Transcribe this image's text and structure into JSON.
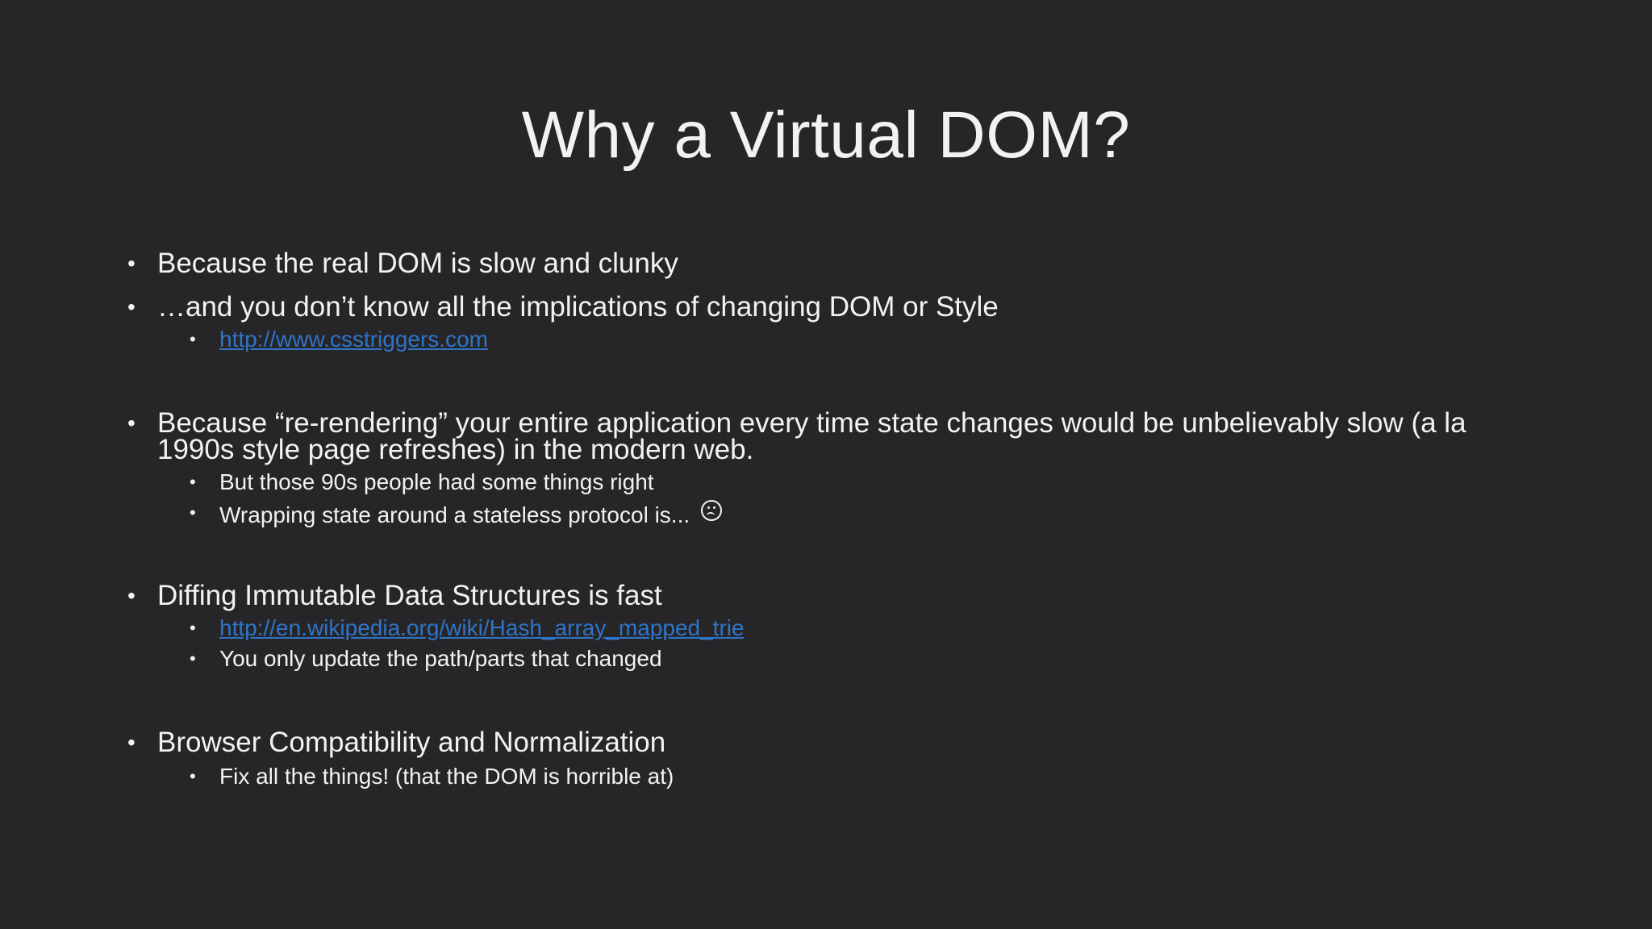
{
  "slide": {
    "title": "Why a Virtual DOM?",
    "bullets": [
      {
        "text": "Because the real DOM is slow and clunky"
      },
      {
        "text": "…and you don’t know all the implications of changing DOM or Style",
        "subs": [
          {
            "text": "http://www.csstriggers.com",
            "link": true
          }
        ]
      },
      {
        "line1": "Because “re-rendering” your entire application every time state changes would be unbelievably slow (a la",
        "line2": "1990s style page refreshes) in the modern web.",
        "subs": [
          {
            "text": "But those 90s people had some things right"
          },
          {
            "text": "Wrapping state around a stateless protocol is...",
            "icon": "frown-face-icon"
          }
        ]
      },
      {
        "text": "Diffing Immutable Data Structures is fast",
        "subs": [
          {
            "text": "http://en.wikipedia.org/wiki/Hash_array_mapped_trie",
            "link": true
          },
          {
            "text": "You only update the path/parts that changed"
          }
        ]
      },
      {
        "text": "Browser Compatibility and Normalization",
        "subs": [
          {
            "text": "Fix all the things! (that the DOM is horrible at)"
          }
        ]
      }
    ],
    "bullet_glyph": "•",
    "colors": {
      "background": "#262527",
      "text": "#f2f2f2",
      "link": "#2f74c8"
    }
  }
}
